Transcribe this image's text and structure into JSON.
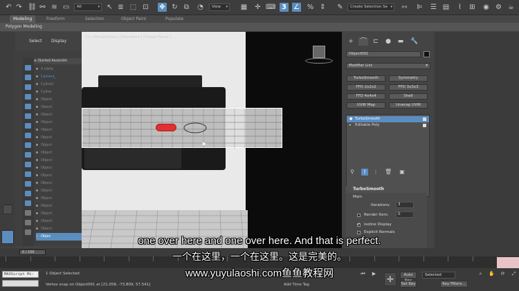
{
  "toolbar": {
    "selection_filter": "All",
    "reference_coord": "View",
    "selection_set": "Create Selection Se",
    "snap_number": "3"
  },
  "ribbon": {
    "tabs": [
      "Modeling",
      "Freeform",
      "Selection",
      "Object Paint",
      "Populate"
    ],
    "active_tab": "Modeling",
    "sub_label": "Polygon Modeling"
  },
  "scene_explorer": {
    "tabs": [
      "Select",
      "Display"
    ],
    "column_header": "Name (Sorted Ascendin",
    "rows": [
      "0 (defa",
      "Camera_",
      "CylineC",
      "Cyline",
      "Object",
      "Object",
      "Object",
      "Object",
      "Object",
      "Object",
      "Object",
      "Object",
      "Object",
      "Object",
      "Object",
      "Object",
      "Object",
      "Object",
      "Object",
      "Object",
      "Object",
      "Object",
      "Objec"
    ]
  },
  "viewport": {
    "label": "[+] [Perspective ] [Standard ] [Edged Faces ]"
  },
  "command_panel": {
    "object_name": "Object091",
    "modifier_list": "Modifier List",
    "modifier_buttons": [
      "TurboSmooth",
      "Symmetry",
      "FFD 2x2x2",
      "FFD 3x3x3",
      "FFD 4x4x4",
      "Shell",
      "UVW Map",
      "Unwrap UVW"
    ],
    "stack": [
      "TurboSmooth",
      "Editable Poly"
    ],
    "rollout": {
      "title": "TurboSmooth",
      "section": "Main",
      "iterations_label": "Iterations:",
      "iterations_value": "3",
      "render_iters_label": "Render Iters:",
      "render_iters_value": "0",
      "isoline_label": "Isoline Display",
      "explicit_label": "Explicit Normals"
    }
  },
  "timeline": {
    "slider": "0 / 100"
  },
  "status": {
    "selected": "1 Object Selected",
    "prompt": "Vertex snap on Object091 at [21.058, -73.809, 57.541]",
    "add_time_tag": "Add Time Tag",
    "auto_key": "Auto Key",
    "set_key": "Set Key",
    "key_mode": "Selected",
    "key_filters": "Key Filters...",
    "maxscript": "MAXScript Mi:"
  },
  "subtitles": {
    "en": "one over here and one over here. And that is perfect.",
    "zh": "一个在这里，一个在这里。这是完美的。",
    "site": "www.yuyulaoshi.com鱼鱼教程网"
  }
}
